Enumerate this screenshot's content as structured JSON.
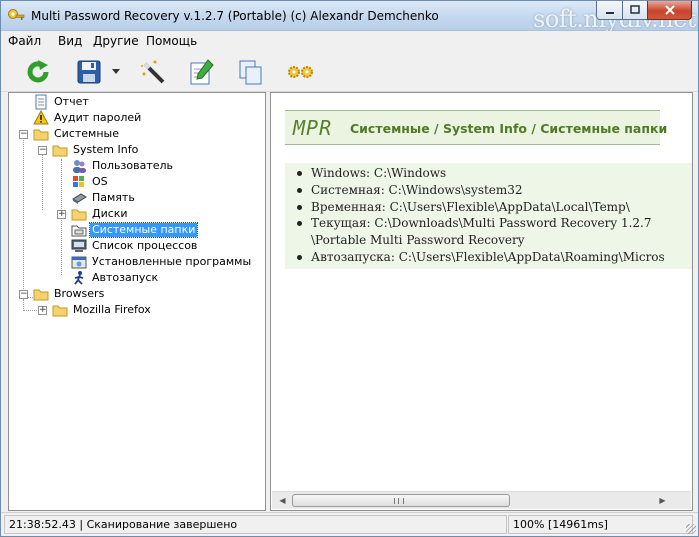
{
  "window": {
    "title": "Multi Password Recovery v.1.2.7 (Portable) (c) Alexandr Demchenko",
    "watermark": "soft.mydiv.net"
  },
  "menu": [
    "Файл",
    "Вид",
    "Другие",
    "Помощь"
  ],
  "toolbar": {
    "icons": [
      "refresh-icon",
      "save-icon",
      "dropdown-arrow-icon",
      "magic-wand-icon",
      "edit-icon",
      "copy-icon",
      "settings-gears-icon"
    ]
  },
  "tree": {
    "nodes": [
      {
        "label": "Отчет",
        "icon": "report-page-icon"
      },
      {
        "label": "Аудит паролей",
        "icon": "warning-icon"
      },
      {
        "label": "Системные",
        "icon": "folder-icon"
      },
      {
        "label": "System Info",
        "icon": "folder-icon"
      },
      {
        "label": "Пользователь",
        "icon": "users-icon"
      },
      {
        "label": "OS",
        "icon": "os-icon"
      },
      {
        "label": "Память",
        "icon": "memory-icon"
      },
      {
        "label": "Диски",
        "icon": "folder-icon"
      },
      {
        "label": "Системные папки",
        "icon": "folder-system-icon"
      },
      {
        "label": "Список процессов",
        "icon": "process-list-icon"
      },
      {
        "label": "Установленные программы",
        "icon": "programs-icon"
      },
      {
        "label": "Автозапуск",
        "icon": "autorun-icon"
      },
      {
        "label": "Browsers",
        "icon": "folder-icon"
      },
      {
        "label": "Mozilla Firefox",
        "icon": "folder-icon"
      }
    ],
    "selected": "Системные папки"
  },
  "content": {
    "logo": "MPR",
    "header": "Системные / System Info / Системные папки",
    "paths": [
      "Windows: C:\\Windows",
      "Системная: C:\\Windows\\system32",
      "Временная: C:\\Users\\Flexible\\AppData\\Local\\Temp\\",
      "Текущая: C:\\Downloads\\Multi Password Recovery 1.2.7",
      "\\Portable Multi Password Recovery",
      "Автозапуска: C:\\Users\\Flexible\\AppData\\Roaming\\Micros"
    ]
  },
  "status": {
    "left": "21:38:52.43 | Сканирование завершено",
    "right": "100% [14961ms]"
  },
  "colors": {
    "selection": "#3399ff",
    "header_green": "#4f7b26",
    "header_bg": "#eaf4e0"
  }
}
